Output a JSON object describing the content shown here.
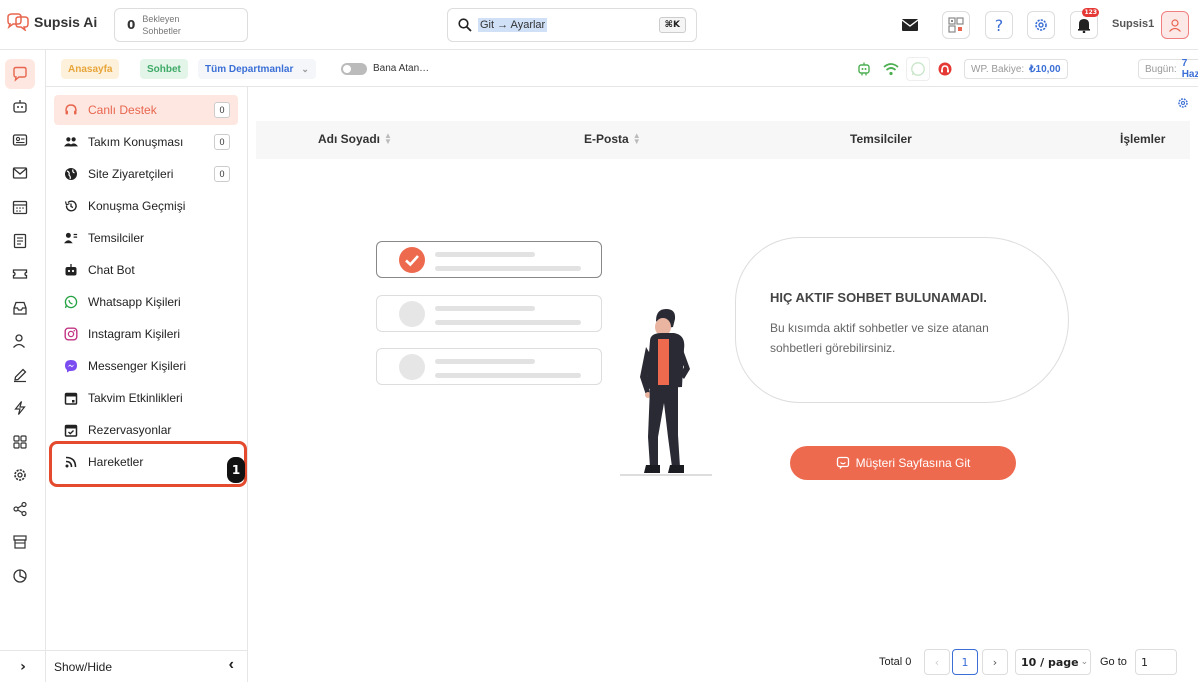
{
  "app": {
    "name": "Supsis Ai"
  },
  "pending": {
    "count": "0",
    "line1": "Bekleyen",
    "line2": "Sohbetler"
  },
  "search": {
    "value": "Git → Ayarlar",
    "shortcut": "⌘K"
  },
  "header": {
    "notification_count": "123",
    "username": "Supsis1"
  },
  "subbar": {
    "home": "Anasayfa",
    "chat": "Sohbet",
    "departments": "Tüm Departmanlar",
    "toggle_label": "Bana Atan…",
    "balance_label": "WP. Bakiye:",
    "balance_value": "₺10,00",
    "today_label": "Bugün:",
    "today_value": "7 Haz"
  },
  "sidebar": {
    "items": [
      {
        "label": "Canlı Destek",
        "count": "0",
        "icon": "headset-icon"
      },
      {
        "label": "Takım Konuşması",
        "count": "0",
        "icon": "team-icon"
      },
      {
        "label": "Site Ziyaretçileri",
        "count": "0",
        "icon": "globe-icon"
      },
      {
        "label": "Konuşma Geçmişi",
        "icon": "history-icon"
      },
      {
        "label": "Temsilciler",
        "icon": "agents-icon"
      },
      {
        "label": "Chat Bot",
        "icon": "bot-icon"
      },
      {
        "label": "Whatsapp Kişileri",
        "icon": "whatsapp-icon"
      },
      {
        "label": "Instagram Kişileri",
        "icon": "instagram-icon"
      },
      {
        "label": "Messenger Kişileri",
        "icon": "messenger-icon"
      },
      {
        "label": "Takvim Etkinlikleri",
        "icon": "calendar-icon"
      },
      {
        "label": "Rezervasyonlar",
        "icon": "calendar-check-icon"
      },
      {
        "label": "Hareketler",
        "icon": "rss-icon"
      }
    ],
    "step_badge": "1",
    "show_hide": "Show/Hide"
  },
  "table": {
    "columns": [
      "Adı Soyadı",
      "E-Posta",
      "Temsilciler",
      "İşlemler"
    ]
  },
  "empty": {
    "title": "HIÇ AKTIF SOHBET BULUNAMADI.",
    "text": "Bu kısımda aktif sohbetler ve size atanan sohbetleri görebilirsiniz.",
    "button": "Müşteri Sayfasına Git"
  },
  "pagination": {
    "total": "Total 0",
    "page": "1",
    "page_size": "10 / page",
    "goto_label": "Go to",
    "goto_value": "1"
  },
  "colors": {
    "accent": "#ed6a4f",
    "link": "#3b6fd6"
  }
}
